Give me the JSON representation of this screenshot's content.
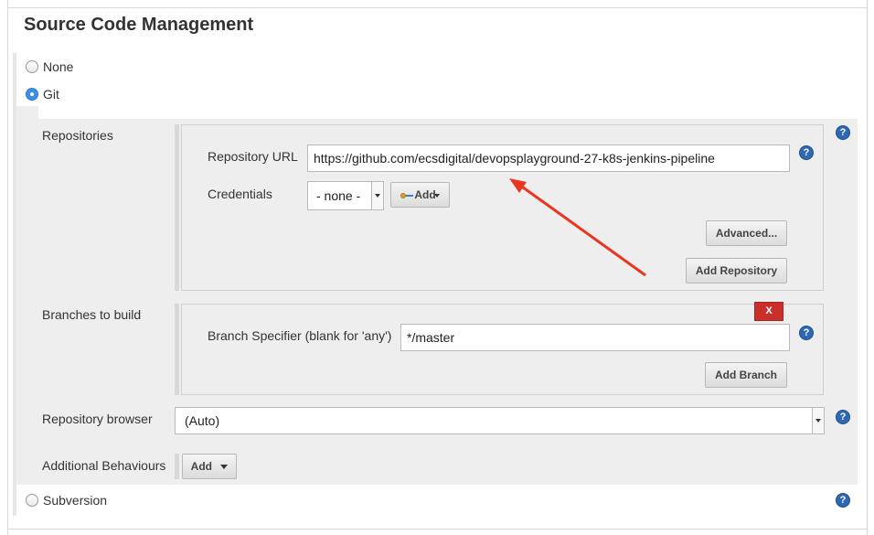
{
  "section": {
    "title": "Source Code Management"
  },
  "scm_options": {
    "none": "None",
    "git": "Git",
    "subversion": "Subversion"
  },
  "repositories": {
    "label": "Repositories",
    "url_label": "Repository URL",
    "url_value": "https://github.com/ecsdigital/devopsplayground-27-k8s-jenkins-pipeline",
    "credentials_label": "Credentials",
    "credentials_value": "- none -",
    "add_credentials_label": "Add",
    "advanced_button": "Advanced...",
    "add_repository_button": "Add Repository"
  },
  "branches": {
    "label": "Branches to build",
    "delete_button": "X",
    "specifier_label": "Branch Specifier (blank for 'any')",
    "specifier_value": "*/master",
    "add_branch_button": "Add Branch"
  },
  "repository_browser": {
    "label": "Repository browser",
    "value": "(Auto)"
  },
  "additional_behaviours": {
    "label": "Additional Behaviours",
    "add_button": "Add"
  },
  "help_icon_glyph": "?",
  "annotation": {
    "arrow_color": "#e8361f"
  }
}
